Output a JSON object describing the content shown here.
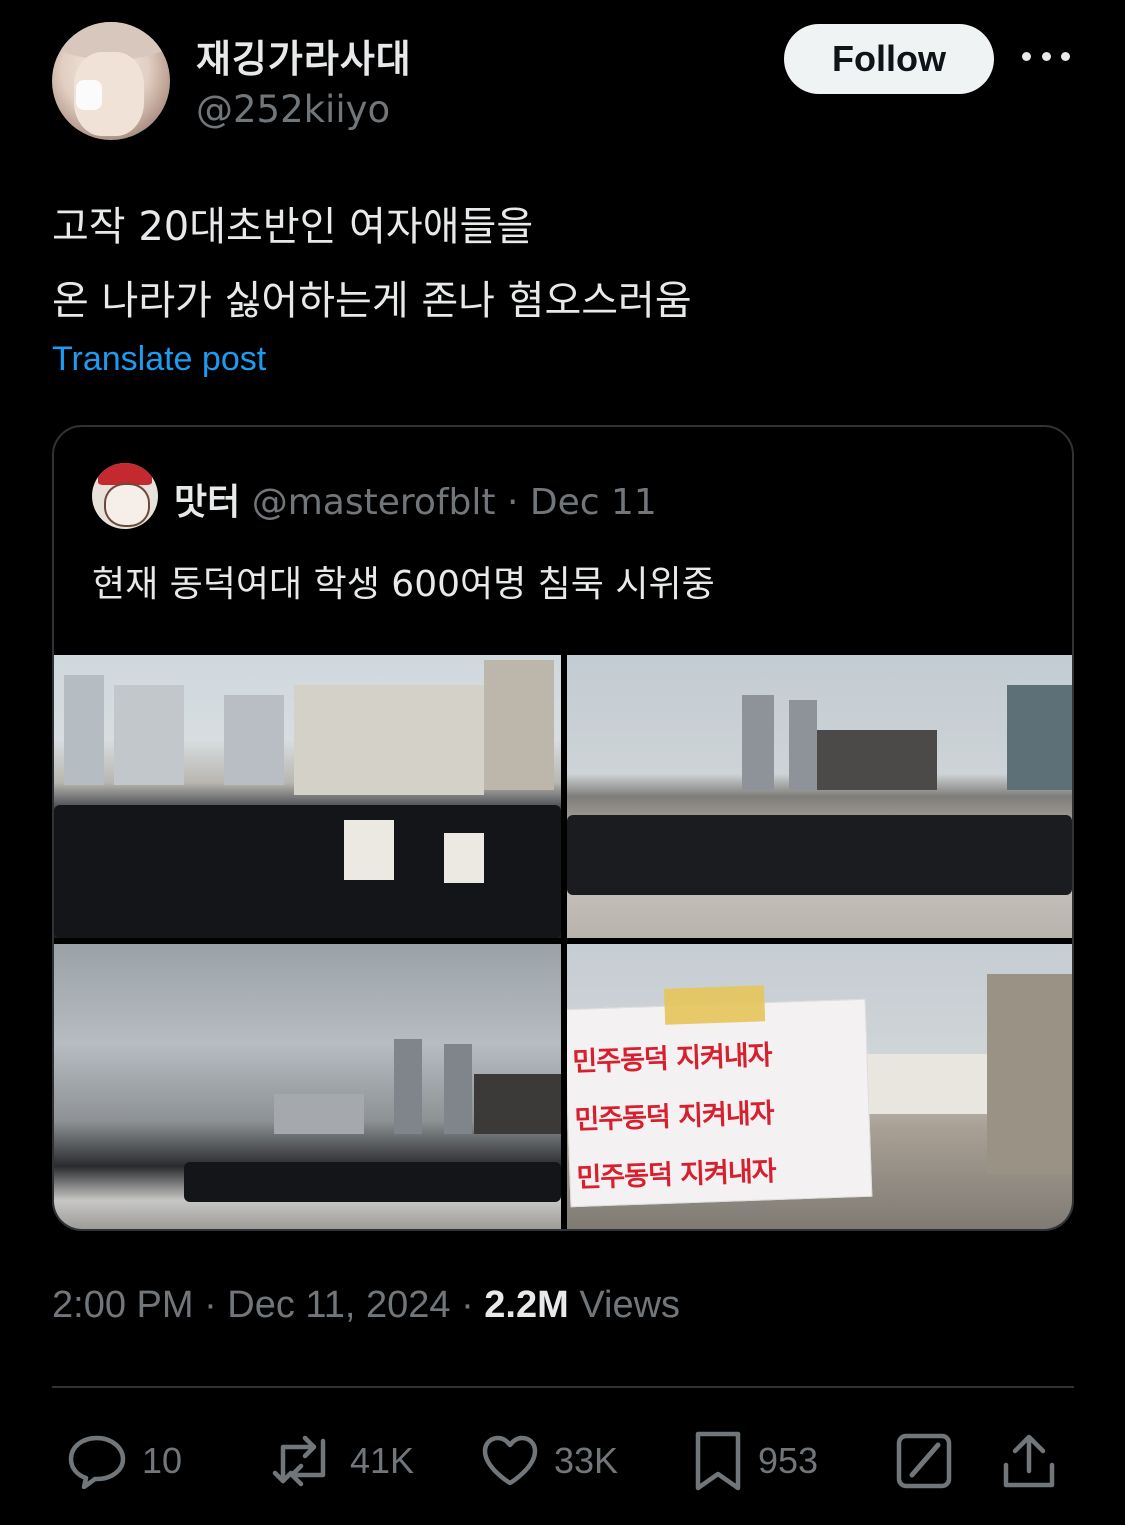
{
  "post": {
    "display_name": "재깅가라사대",
    "handle": "@252kiiyo",
    "follow_label": "Follow",
    "text_lines": [
      "고작 20대초반인 여자애들을",
      "온 나라가 싫어하는게 존나 혐오스러움"
    ],
    "translate_label": "Translate post",
    "timestamp": "2:00 PM · Dec 11, 2024 · ",
    "views_count": "2.2M",
    "views_label": " Views"
  },
  "quote": {
    "display_name": "맛터",
    "handle": "@masterofblt",
    "separator": " · ",
    "date": "Dec 11",
    "text": "현재 동덕여대 학생 600여명 침묵 시위중",
    "sign_lines": [
      "민주동덕 지켜내자",
      "민주동덕 지켜내자",
      "민주동덕 지켜내자"
    ]
  },
  "actions": {
    "replies": "10",
    "reposts": "41K",
    "likes": "33K",
    "bookmarks": "953"
  },
  "icons": [
    "more-icon",
    "reply-icon",
    "repost-icon",
    "like-icon",
    "bookmark-icon",
    "grok-icon",
    "share-icon"
  ],
  "colors": {
    "background": "#000000",
    "text": "#e7e9ea",
    "muted": "#71767b",
    "link": "#1d9bf0",
    "follow_bg": "#eff3f4"
  }
}
